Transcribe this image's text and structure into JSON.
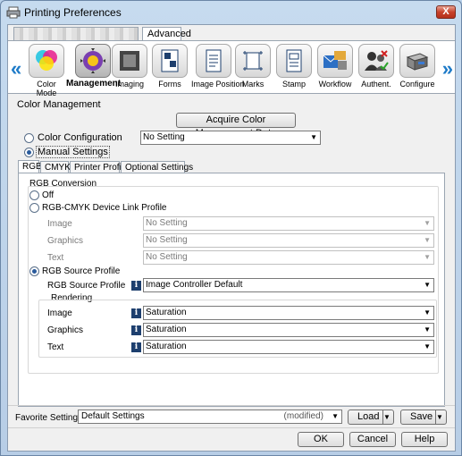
{
  "window": {
    "title": "Printing Preferences",
    "close_label": "X"
  },
  "top_tabs": {
    "advanced": "Advanced"
  },
  "icon_strip": {
    "items": [
      {
        "label": "Color Mode",
        "icon": "color-mode-icon"
      },
      {
        "label": "Management",
        "icon": "management-icon",
        "selected": true
      },
      {
        "label": "Imaging",
        "icon": "imaging-icon"
      },
      {
        "label": "Forms",
        "icon": "forms-icon"
      },
      {
        "label": "Image Position",
        "icon": "image-position-icon"
      },
      {
        "label": "Marks",
        "icon": "marks-icon"
      },
      {
        "label": "Stamp",
        "icon": "stamp-icon"
      },
      {
        "label": "Workflow",
        "icon": "workflow-icon"
      },
      {
        "label": "Authent.",
        "icon": "authentication-icon"
      },
      {
        "label": "Configure",
        "icon": "configure-icon"
      }
    ]
  },
  "color_management": {
    "section_title": "Color Management",
    "acquire_button": "Acquire Color Management Data",
    "color_configuration_label": "Color Configuration",
    "color_configuration_value": "No Setting",
    "manual_settings_label": "Manual Settings"
  },
  "inner_tabs": [
    "RGB",
    "CMYK",
    "Printer Profile",
    "Optional Settings"
  ],
  "rgb_conversion": {
    "title": "RGB Conversion",
    "off_label": "Off",
    "device_link_label": "RGB-CMYK Device Link Profile",
    "device_link_rows": [
      {
        "label": "Image",
        "value": "No Setting"
      },
      {
        "label": "Graphics",
        "value": "No Setting"
      },
      {
        "label": "Text",
        "value": "No Setting"
      }
    ],
    "source_profile_label": "RGB Source Profile",
    "source_profile_row_label": "RGB Source Profile",
    "source_profile_value": "Image Controller Default",
    "rendering_title": "Rendering",
    "rendering_rows": [
      {
        "label": "Image",
        "value": "Saturation"
      },
      {
        "label": "Graphics",
        "value": "Saturation"
      },
      {
        "label": "Text",
        "value": "Saturation"
      }
    ]
  },
  "footer": {
    "favorite_label": "Favorite Setting",
    "favorite_value": "Default Settings",
    "modified_text": "(modified)",
    "load_label": "Load",
    "save_label": "Save",
    "ok_label": "OK",
    "cancel_label": "Cancel",
    "help_label": "Help"
  }
}
